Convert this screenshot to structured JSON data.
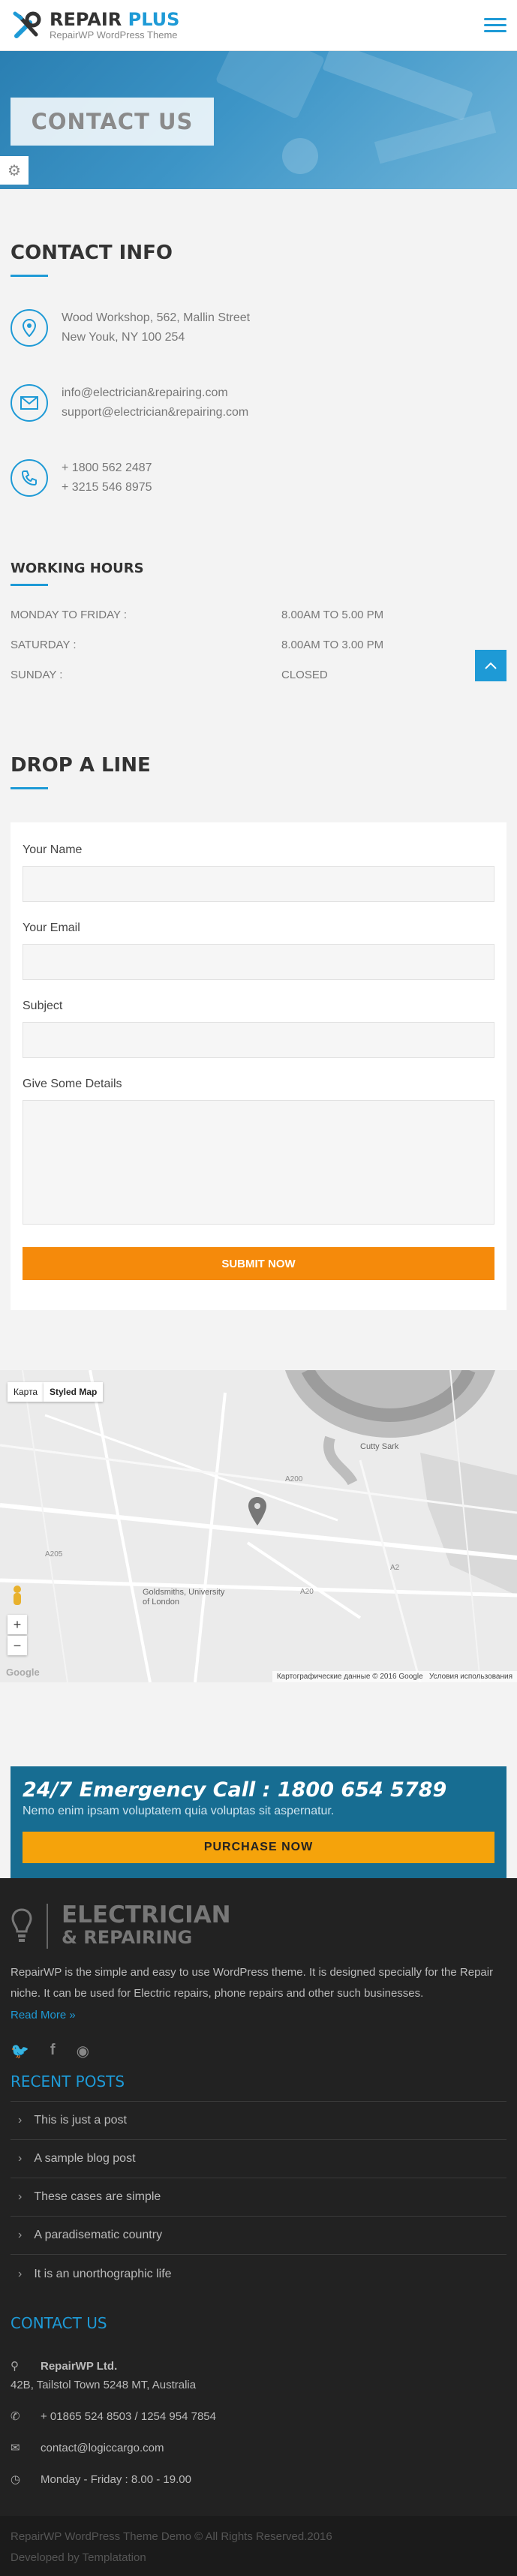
{
  "header": {
    "brand_main": "REPAIR",
    "brand_accent": "PLUS",
    "tagline": "RepairWP  WordPress Theme",
    "menu_icon": "hamburger-icon"
  },
  "hero": {
    "title": "CONTACT US",
    "settings_icon": "gear-icon"
  },
  "contact_info": {
    "title": "CONTACT INFO",
    "address": [
      "Wood Workshop, 562, Mallin Street",
      "New Youk, NY 100 254"
    ],
    "emails": [
      "info@electrician&repairing.com",
      "support@electrician&repairing.com"
    ],
    "phones": [
      "+ 1800 562 2487",
      "+ 3215 546 8975"
    ]
  },
  "working_hours": {
    "title": "WORKING HOURS",
    "rows": [
      {
        "day": "MONDAY TO FRIDAY :",
        "time": "8.00AM TO 5.00 PM"
      },
      {
        "day": "SATURDAY :",
        "time": "8.00AM TO 3.00 PM"
      },
      {
        "day": "SUNDAY :",
        "time": "CLOSED"
      }
    ]
  },
  "form": {
    "title": "DROP A LINE",
    "name_label": "Your Name",
    "email_label": "Your Email",
    "subject_label": "Subject",
    "details_label": "Give Some Details",
    "submit_label": "SUBMIT NOW"
  },
  "map": {
    "tab_map": "Карта",
    "tab_styled": "Styled Map",
    "labels": {
      "cutty": "Cutty Sark",
      "goldsmiths": "Goldsmiths, University of London",
      "a2": "A2",
      "a20": "A20",
      "a200": "A200",
      "a205": "A205"
    },
    "credit_data": "Картографические данные © 2016 Google",
    "credit_terms": "Условия использования",
    "google": "Google"
  },
  "emergency": {
    "title": "24/7 Emergency Call : 1800 654 5789",
    "subtitle": "Nemo enim ipsam voluptatem quia voluptas sit aspernatur.",
    "button": "PURCHASE NOW"
  },
  "footer": {
    "logo_line1": "ELECTRICIAN",
    "logo_line2": "& REPAIRING",
    "description": "RepairWP is the simple and easy to use WordPress theme. It is designed specially for the Repair niche. It can be used for Electric repairs, phone repairs and other such businesses.",
    "read_more": "Read More »",
    "recent_posts_title": "RECENT POSTS",
    "posts": [
      "This is just a post",
      "A sample blog post",
      "These cases are simple",
      "A paradisematic country",
      "It is an unorthographic life"
    ],
    "contact_title": "CONTACT US",
    "company": "RepairWP Ltd.",
    "company_address": "42B, Tailstol Town 5248 MT, Australia",
    "phone": "+ 01865 524 8503 / 1254 954 7854",
    "email": "contact@logiccargo.com",
    "hours": "Monday - Friday : 8.00 - 19.00"
  },
  "bottom_bar": {
    "copyright": "RepairWP WordPress Theme Demo © All Rights Reserved.2016",
    "developed": "Developed by Templatation"
  },
  "colors": {
    "accent": "#1e9ad6",
    "orange": "#f58a0b",
    "yellow": "#f5a30b",
    "footer_bg": "#222222"
  }
}
